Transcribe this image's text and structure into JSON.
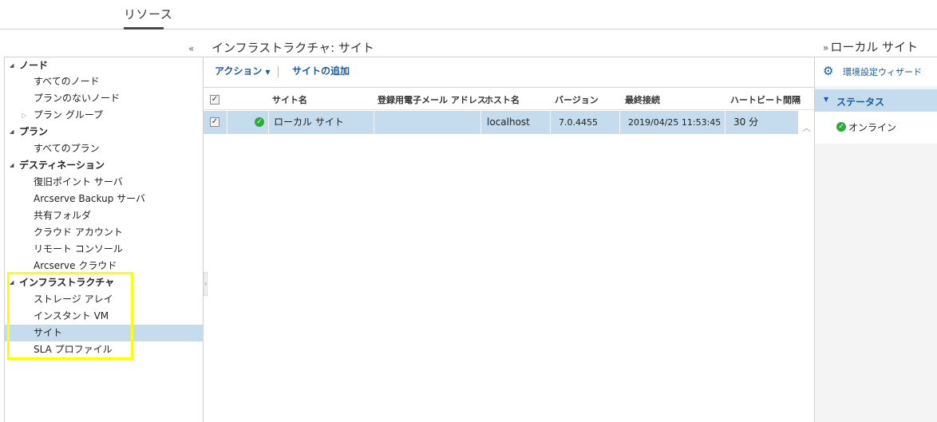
{
  "top_tab": "リソース",
  "collapse_left_icon": "«",
  "main_title": "インフラストラクチャ: サイト",
  "right_title": "ローカル サイト",
  "right_title_icon": "»",
  "tree": {
    "nodes": "ノード",
    "all_nodes": "すべてのノード",
    "nodes_without_plan": "プランのないノード",
    "plan_groups": "プラン グループ",
    "plans": "プラン",
    "all_plans": "すべてのプラン",
    "destinations": "デスティネーション",
    "recovery_point_server": "復旧ポイント サーバ",
    "arcserve_backup_server": "Arcserve Backup サーバ",
    "shared_folder": "共有フォルダ",
    "cloud_account": "クラウド アカウント",
    "remote_console": "リモート コンソール",
    "arcserve_cloud": "Arcserve クラウド",
    "infrastructure": "インフラストラクチャ",
    "storage_array": "ストレージ アレイ",
    "instant_vm": "インスタント VM",
    "sites": "サイト",
    "sla_profile": "SLA プロファイル"
  },
  "toolbar": {
    "action_label": "アクション",
    "add_site_label": "サイトの追加"
  },
  "grid": {
    "headers": {
      "site_name": "サイト名",
      "email": "登録用電子メール アドレス",
      "host_name": "ホスト名",
      "version": "バージョン",
      "last_connection": "最終接続",
      "heartbeat": "ハートビート間隔"
    },
    "rows": [
      {
        "site_name": "ローカル サイト",
        "email": "",
        "host_name": "localhost",
        "version": "7.0.4455",
        "last_connection": "2019/04/25 11:53:45",
        "heartbeat": "30 分"
      }
    ]
  },
  "right_panel": {
    "wizard_label": "環境設定ウィザード",
    "status_title": "ステータス",
    "status_value": "オンライン"
  },
  "colors": {
    "accent": "#1a5aa0",
    "selection": "#c4dced",
    "highlight": "#ffff00",
    "ok": "#2eab3c"
  },
  "icons": [
    "collapse-left-icon",
    "expand-right-icon",
    "tree-toggle-icon",
    "checkbox-icon",
    "status-ok-icon",
    "gear-icon",
    "chevron-down-icon",
    "scroll-up-icon"
  ]
}
